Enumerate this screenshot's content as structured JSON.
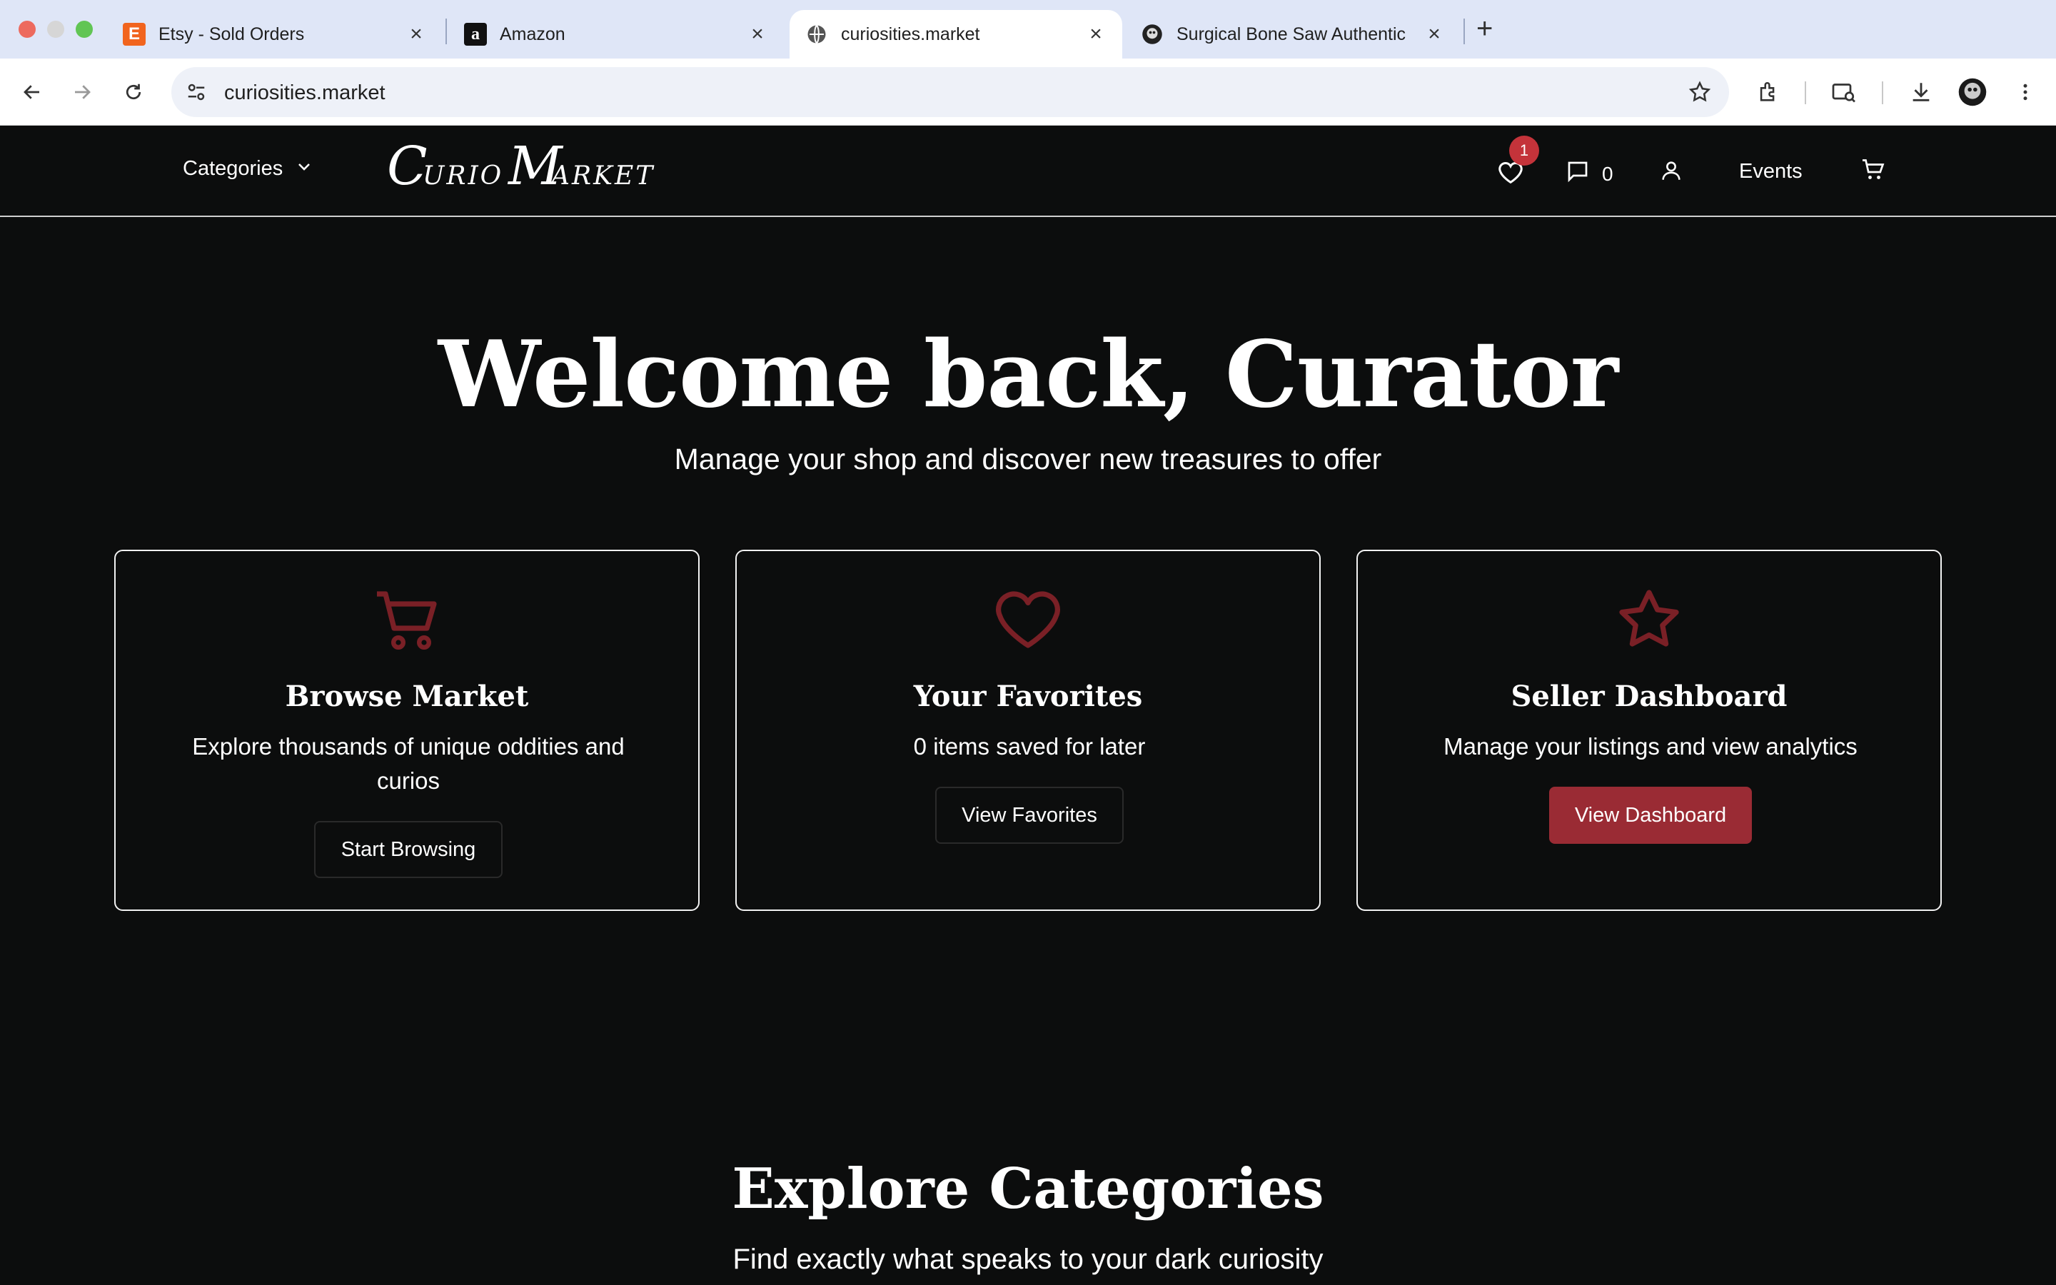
{
  "browser": {
    "tabs": [
      {
        "title": "Etsy - Sold Orders",
        "favicon": "E"
      },
      {
        "title": "Amazon",
        "favicon": "a"
      },
      {
        "title": "curiosities.market",
        "favicon": "globe-icon"
      },
      {
        "title": "Surgical Bone Saw Authentic",
        "favicon": "skull-icon"
      }
    ],
    "url": "curiosities.market"
  },
  "header": {
    "categories_label": "Categories",
    "logo_text": "Curio Market",
    "favorites_badge": "1",
    "messages_count": "0",
    "events_label": "Events"
  },
  "hero": {
    "title": "Welcome back, Curator",
    "subtitle": "Manage your shop and discover new treasures to offer"
  },
  "cards": [
    {
      "icon": "cart-icon",
      "title": "Browse Market",
      "description": "Explore thousands of unique oddities and curios",
      "button": "Start Browsing"
    },
    {
      "icon": "heart-icon",
      "title": "Your Favorites",
      "description": "0 items saved for later",
      "button": "View Favorites"
    },
    {
      "icon": "star-icon",
      "title": "Seller Dashboard",
      "description": "Manage your listings and view analytics",
      "button": "View Dashboard"
    }
  ],
  "categories_section": {
    "title": "Explore Categories",
    "subtitle": "Find exactly what speaks to your dark curiosity"
  },
  "colors": {
    "accent": "#9a2b34",
    "icon_red": "#7a2026",
    "badge": "#c4333a",
    "background": "#0c0d0d"
  }
}
